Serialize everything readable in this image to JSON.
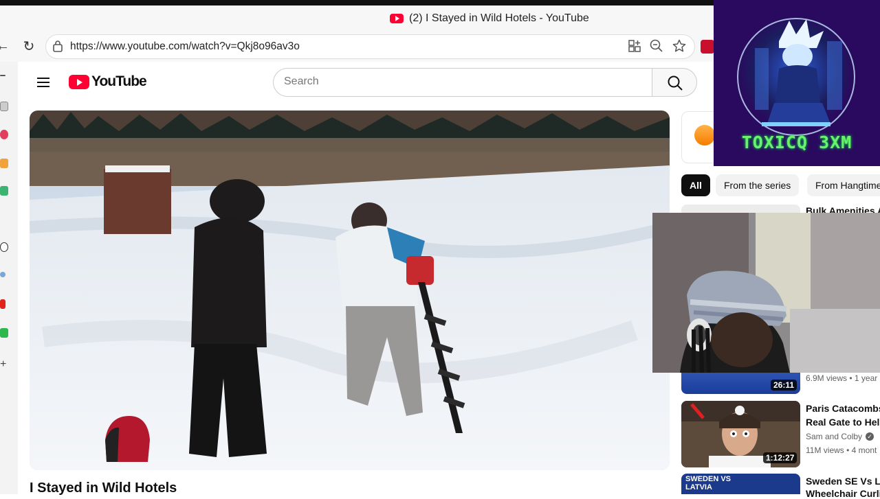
{
  "browser": {
    "tab_title": "(2) I Stayed in Wild Hotels - YouTube",
    "url": "https://www.youtube.com/watch?v=Qkj8o96av3o"
  },
  "youtube": {
    "logo_text": "YouTube",
    "search_placeholder": "Search",
    "video_title": "I Stayed in Wild Hotels"
  },
  "sidebar": {
    "chips": [
      "All",
      "From the series",
      "From Hangtime"
    ],
    "recommendations": [
      {
        "title": "Bulk Amenities A"
      },
      {
        "duration": "26:11",
        "meta": "6.9M views • 1 year"
      },
      {
        "title_line1": "Paris Catacombs",
        "title_line2": "Real Gate to Hell",
        "channel": "Sam and Colby",
        "duration": "1:12:27",
        "meta": "11M views • 4 mont"
      },
      {
        "thumb_text_line1": "SWEDEN VS",
        "thumb_text_line2": "LATVIA",
        "title_line1": "Sweden SE Vs LV",
        "title_line2": "Wheelchair Curli"
      }
    ]
  },
  "overlay": {
    "streamer_tag": "TOXICQ 3XM"
  },
  "colors": {
    "youtube_red": "#ff0033",
    "overlay_bg": "#2a0a5e",
    "overlay_text": "#6df06d"
  }
}
